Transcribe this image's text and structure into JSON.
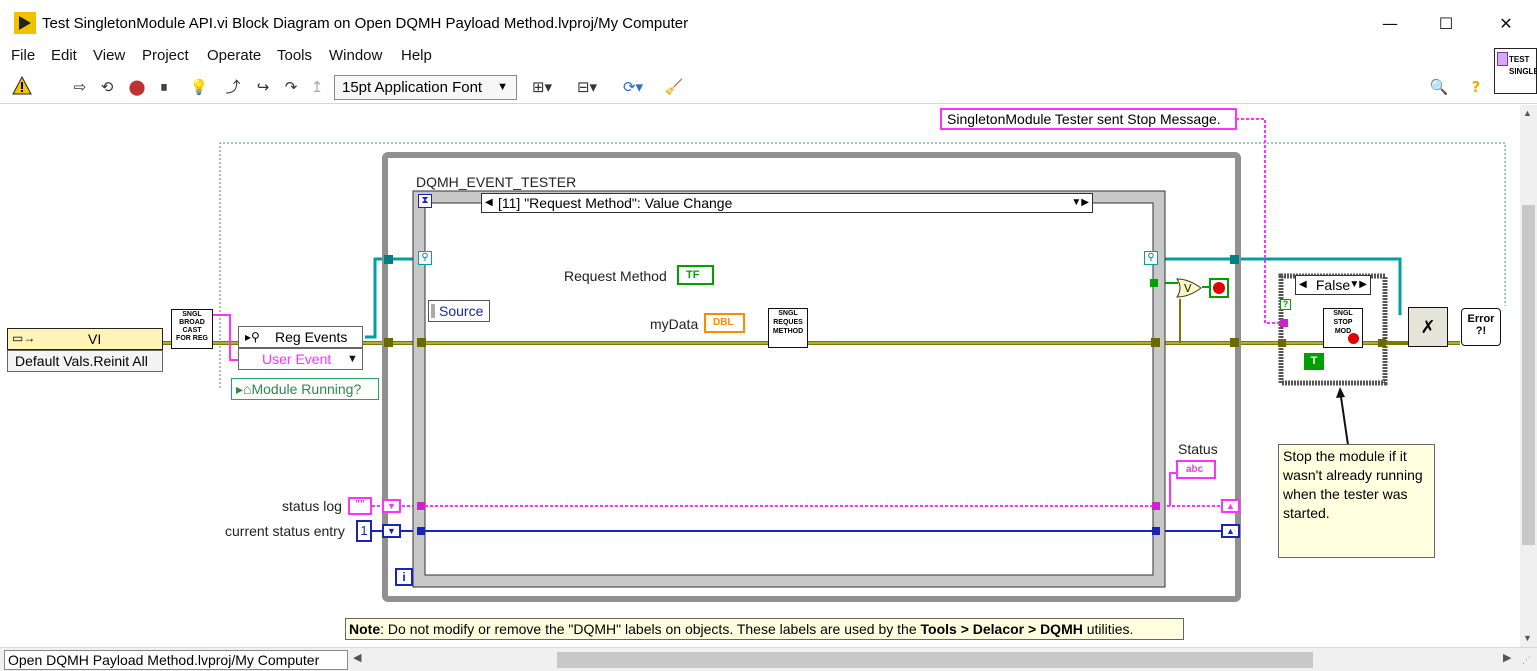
{
  "window": {
    "title": "Test SingletonModule API.vi Block Diagram on Open DQMH Payload Method.lvproj/My Computer",
    "minimize_label": "—",
    "maximize_label": "☐",
    "close_label": "✕",
    "connector_icon_text": "TEST\nSINGLE"
  },
  "menu": {
    "items": [
      "File",
      "Edit",
      "View",
      "Project",
      "Operate",
      "Tools",
      "Window",
      "Help"
    ]
  },
  "toolbar": {
    "font_value": "15pt Application Font"
  },
  "status_bar": {
    "project_path": "Open DQMH Payload Method.lvproj/My Computer"
  },
  "diagram": {
    "vi_constant": {
      "type_label": "VI",
      "value_label": "Default Vals.Reinit All"
    },
    "broadcast_node_text": "SNGL\nBROAD\nCAST\nFOR REG",
    "reg_events_label": "Reg Events",
    "user_event_label": "User Event",
    "module_running_label": "Module Running?",
    "event_structure_label": "DQMH_EVENT_TESTER",
    "event_case_selector": "[11] \"Request Method\": Value Change",
    "source_label": "Source",
    "request_method_label": "Request Method",
    "request_method_terminal": "TF",
    "mydata_label": "myData",
    "mydata_terminal": "DBL",
    "request_method_node_text": "SNGL\nREQUES\nMETHOD",
    "status_label": "Status",
    "status_terminal": "abc",
    "status_log_label": "status log",
    "status_log_constant": "\"\"",
    "current_status_entry_label": "current status entry",
    "current_status_entry_constant": "1",
    "stop_message_constant": "SingletonModule Tester sent Stop Message.",
    "case_selector_value": "False",
    "stop_module_node_text": "SNGL\nSTOP\nMOD",
    "true_constant": "T",
    "error_node_text": "Error\n?!",
    "comment_text": "Stop the module if it wasn't already running when the tester was started.",
    "note": {
      "prefix": "Note",
      "text_1": ": Do not modify or remove the \"DQMH\" labels on objects. These labels are used by the ",
      "bold_path": "Tools > Delacor > DQMH",
      "text_2": " utilities."
    },
    "colors": {
      "event_wire": "#00a0a0",
      "cluster_wire": "#7a7a00",
      "string_wire": "#ff32ff",
      "integer_wire": "#1a24b8",
      "boolean": "#00a000",
      "double": "#ff8a00",
      "loop_frame": "#909090"
    }
  }
}
